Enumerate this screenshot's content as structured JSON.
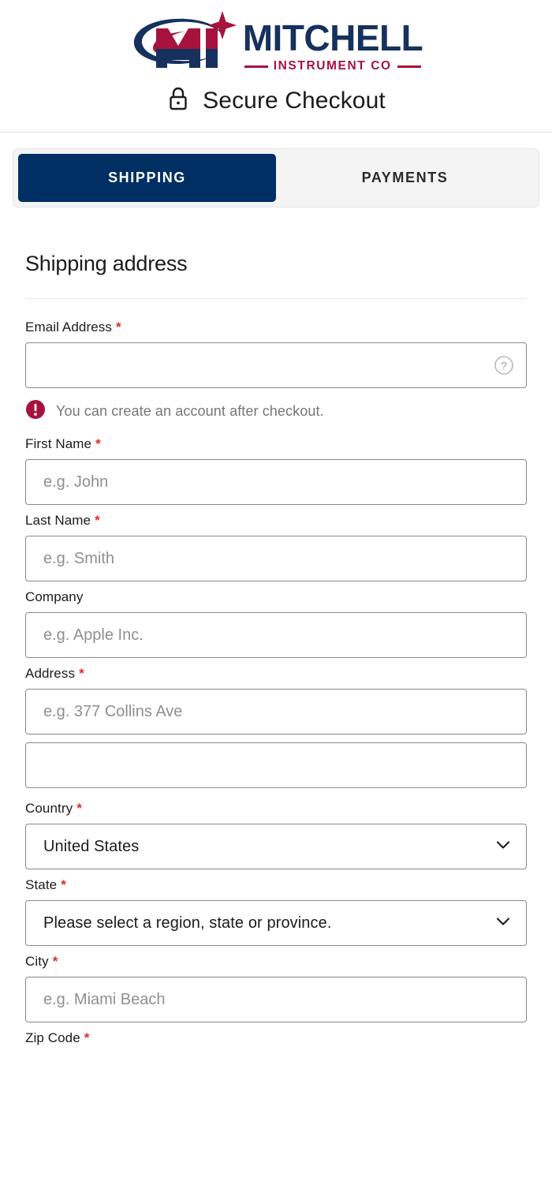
{
  "brand": {
    "logo_word": "MITCHELL",
    "logo_sub": "INSTRUMENT CO",
    "navy": "#16315e",
    "crimson": "#a8123e",
    "tab_navy": "#003063",
    "required_red": "#e02b27"
  },
  "header": {
    "secure_title": "Secure Checkout",
    "lock_icon": "lock-icon"
  },
  "tabs": [
    {
      "label": "SHIPPING",
      "active": true
    },
    {
      "label": "PAYMENTS",
      "active": false
    }
  ],
  "shipping": {
    "section_title": "Shipping address",
    "required_marker": "*",
    "fields": {
      "email": {
        "label": "Email Address",
        "required": true,
        "value": "",
        "placeholder": "",
        "help_icon": "question-circle-icon"
      },
      "email_note": {
        "icon": "alert-circle-icon",
        "text": "You can create an account after checkout."
      },
      "first_name": {
        "label": "First Name",
        "required": true,
        "value": "",
        "placeholder": "e.g. John"
      },
      "last_name": {
        "label": "Last Name",
        "required": true,
        "value": "",
        "placeholder": "e.g. Smith"
      },
      "company": {
        "label": "Company",
        "required": false,
        "value": "",
        "placeholder": "e.g. Apple Inc."
      },
      "address1": {
        "label": "Address",
        "required": true,
        "value": "",
        "placeholder": "e.g. 377 Collins Ave"
      },
      "address2": {
        "label": "",
        "required": false,
        "value": "",
        "placeholder": ""
      },
      "country": {
        "label": "Country",
        "required": true,
        "selected": "United States",
        "chevron": "chevron-down-icon"
      },
      "state": {
        "label": "State",
        "required": true,
        "selected": "Please select a region, state or province.",
        "chevron": "chevron-down-icon"
      },
      "city": {
        "label": "City",
        "required": true,
        "value": "",
        "placeholder": "e.g. Miami Beach"
      },
      "zip": {
        "label": "Zip Code",
        "required": true,
        "value": "",
        "placeholder": ""
      }
    }
  }
}
